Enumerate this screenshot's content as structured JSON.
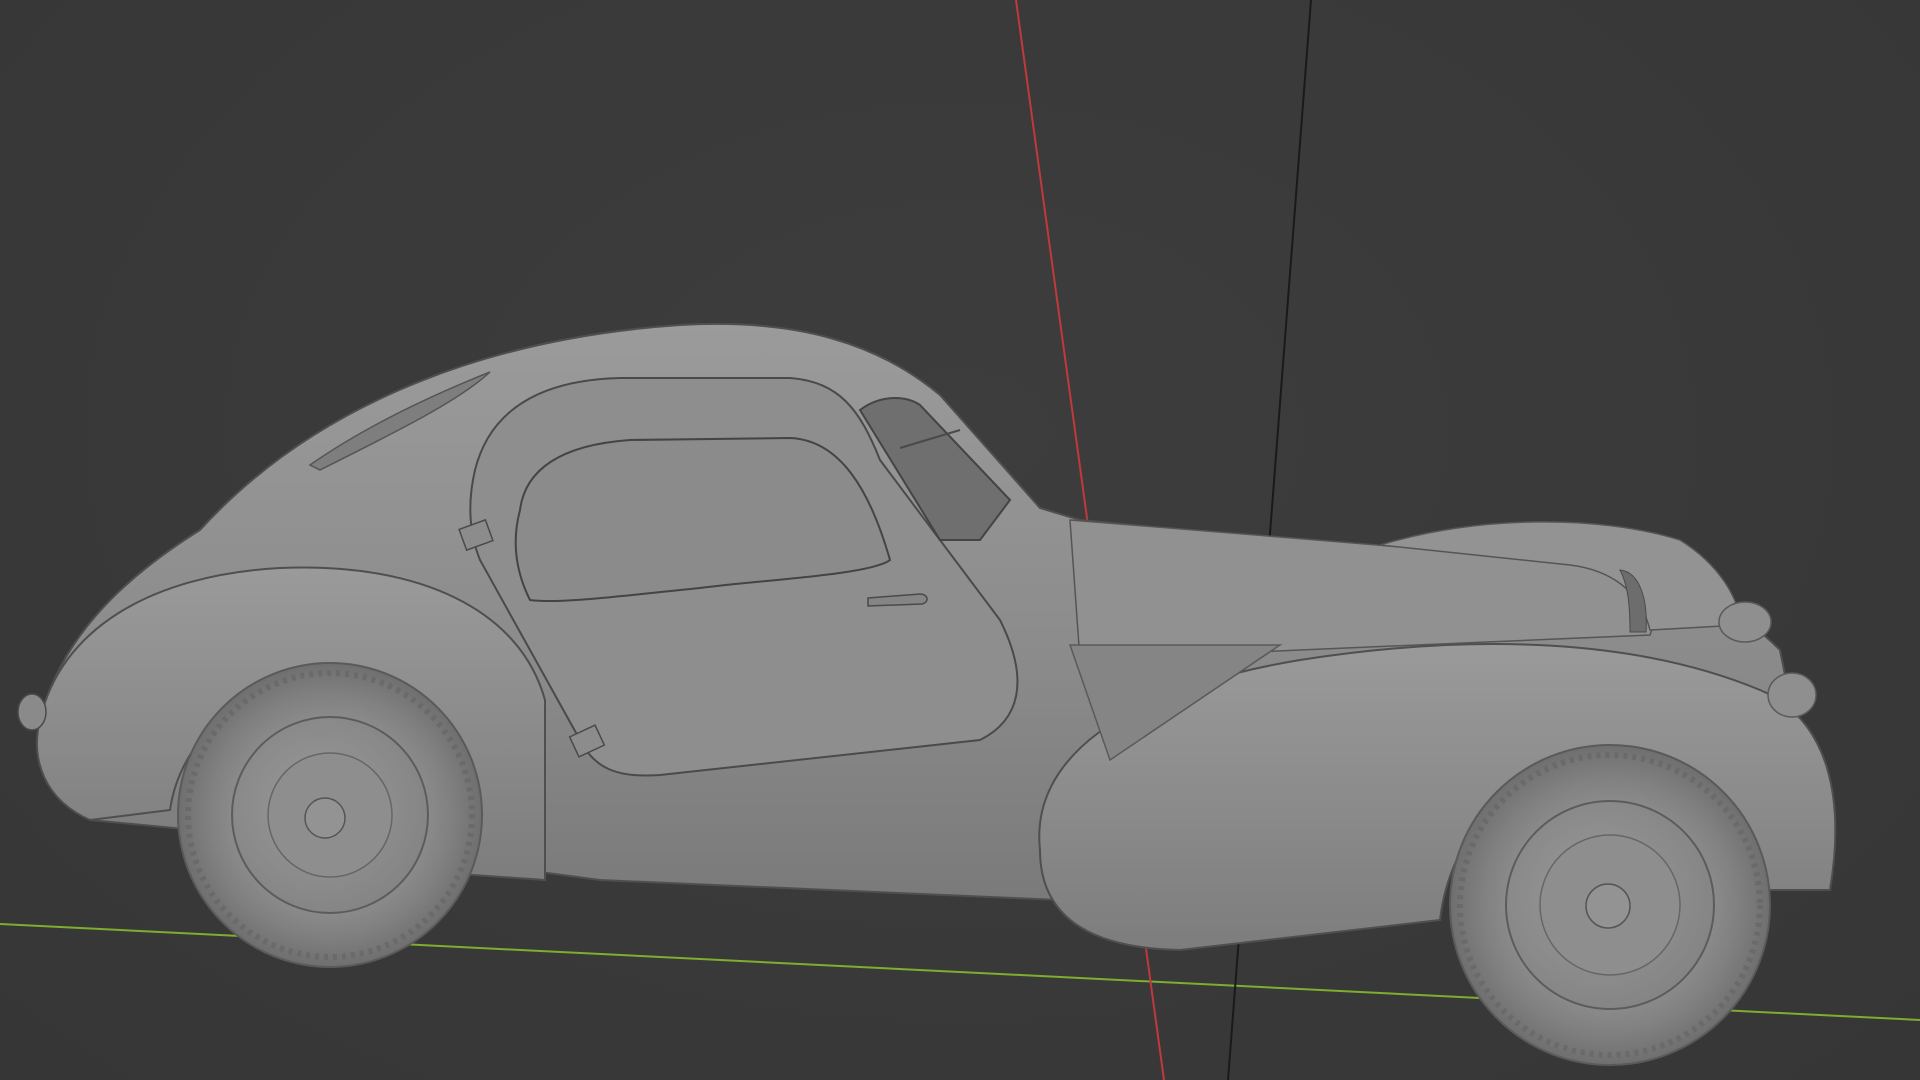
{
  "viewport": {
    "mode": "3D Viewport",
    "shading": "solid"
  },
  "scene": {
    "object": "car-model",
    "background_color": "#393939",
    "axis_colors": {
      "x_axis": "#c0393b",
      "y_axis": "#7fae2f",
      "z_axis": "#1a1a1a"
    },
    "solid_colors": {
      "body": "#8f8f8f",
      "body_shadow": "#7c7c7c",
      "tire": "#8a8a8a",
      "outline": "#4a4a4a"
    }
  }
}
